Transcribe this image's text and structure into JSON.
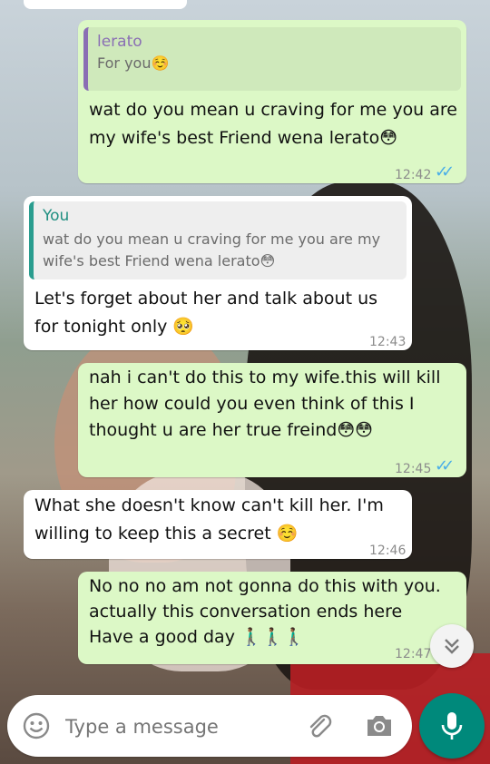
{
  "messages": [
    {
      "direction": "outgoing",
      "quote": {
        "author": "lerato",
        "text": "For you☺️"
      },
      "text": "wat do you mean u craving for me you are\nmy wife's best Friend wena lerato😳",
      "time": "12:42",
      "ticks": "✓✓"
    },
    {
      "direction": "incoming",
      "quote": {
        "author": "You",
        "text": "wat do you mean u craving for me you are my\nwife's best Friend wena lerato😳"
      },
      "text": "Let's forget about her and talk about us\nfor tonight only 🥺",
      "time": "12:43"
    },
    {
      "direction": "outgoing",
      "text": "nah i can't do this to my wife.this will kill\nher how could you even think of this I\nthought u are her true freind😳😳",
      "time": "12:45",
      "ticks": "✓✓"
    },
    {
      "direction": "incoming",
      "text": "What she doesn't know can't kill her. I'm\nwilling to keep this a secret ☺️",
      "time": "12:46"
    },
    {
      "direction": "outgoing",
      "text": "No no no am not gonna do this with you.\nactually this conversation ends here\nHave a good day 🚶🏾‍♂️🚶🏾‍♂️🚶🏾‍♂️",
      "time": "12:47"
    }
  ],
  "composer": {
    "placeholder": "Type a message",
    "emoji_icon": "emoji-icon",
    "attach_icon": "paperclip-icon",
    "camera_icon": "camera-icon",
    "mic_icon": "microphone-icon"
  },
  "scroll_down_icon": "double-chevron-down-icon",
  "colors": {
    "outgoing_bubble": "#dcf8c6",
    "incoming_bubble": "#ffffff",
    "read_ticks": "#4aaee8",
    "accent": "#00897b"
  }
}
